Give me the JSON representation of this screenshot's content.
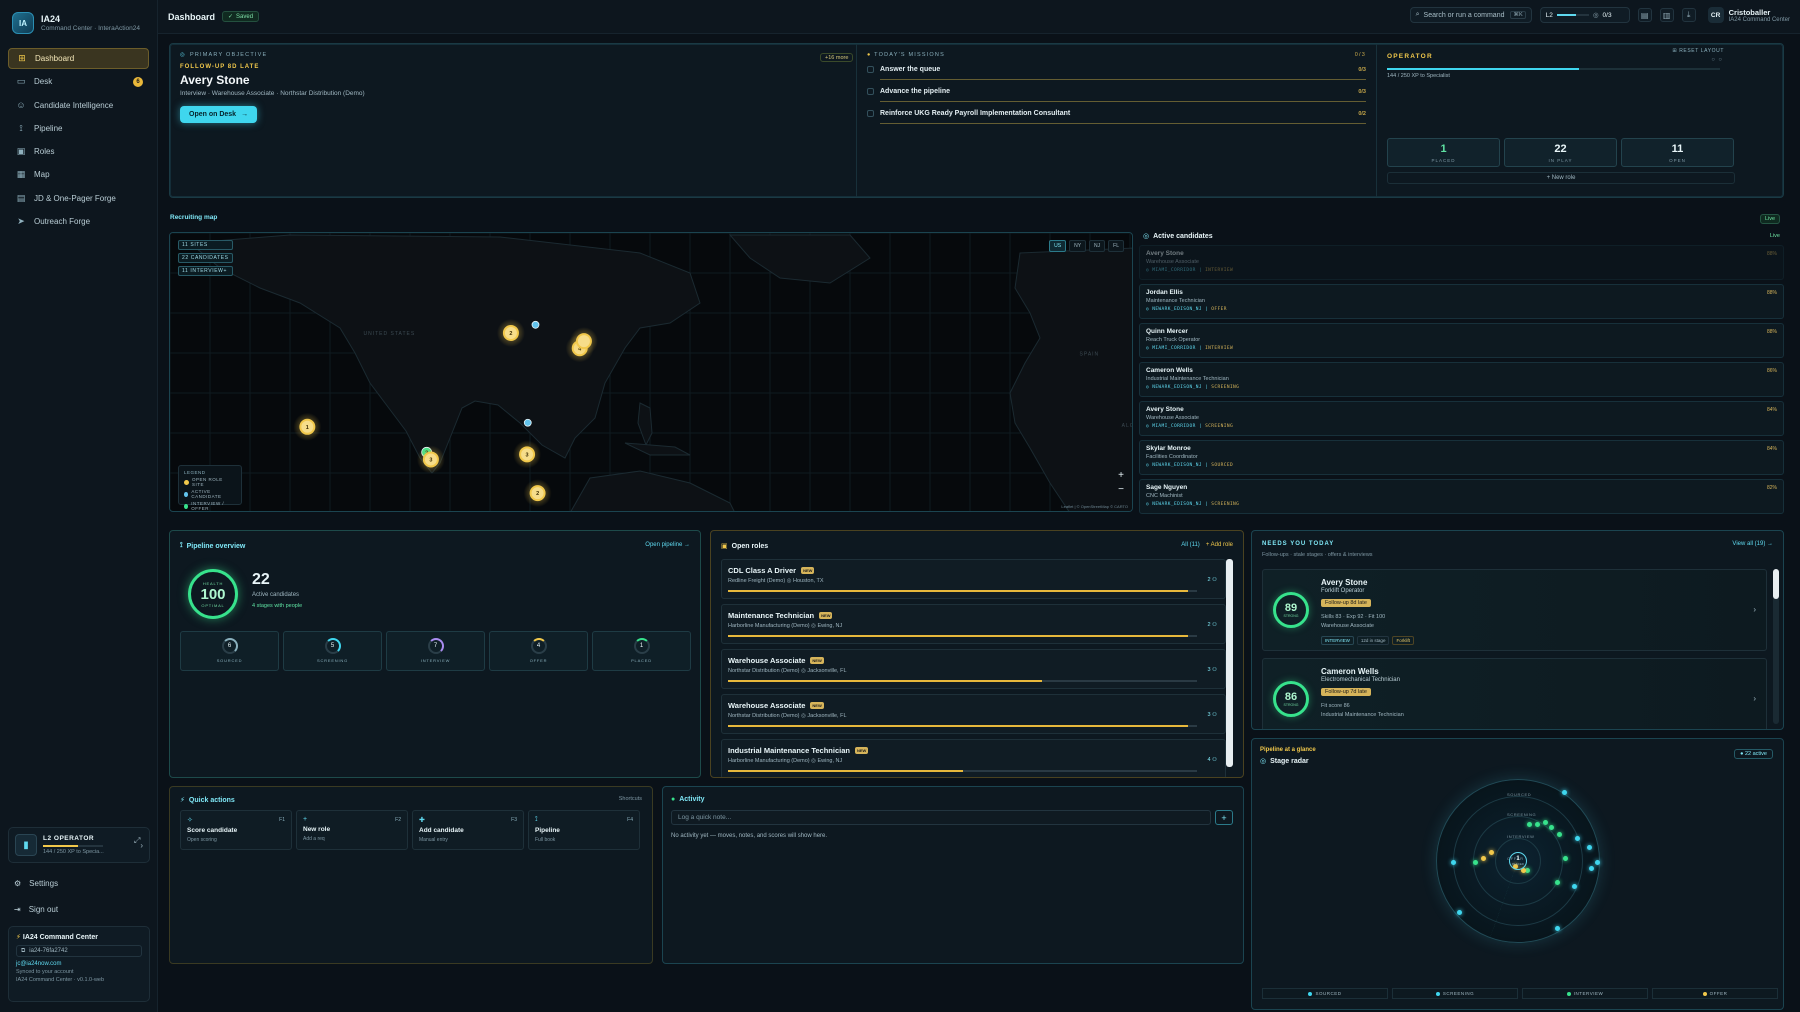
{
  "brand": {
    "title": "IA24",
    "subtitle": "Command Center · InteraAction24",
    "logo": "IA"
  },
  "nav": [
    {
      "label": "Dashboard",
      "icon": "grid-icon",
      "active": true
    },
    {
      "label": "Desk",
      "icon": "desk-icon",
      "badge": "6"
    },
    {
      "label": "Candidate Intelligence",
      "icon": "people-icon"
    },
    {
      "label": "Pipeline",
      "icon": "pipeline-icon"
    },
    {
      "label": "Roles",
      "icon": "briefcase-icon"
    },
    {
      "label": "Map",
      "icon": "map-icon"
    },
    {
      "label": "JD & One-Pager Forge",
      "icon": "document-icon"
    },
    {
      "label": "Outreach Forge",
      "icon": "send-icon"
    }
  ],
  "sidebar_operator": {
    "title": "L2 OPERATOR",
    "xp": "144 / 250 XP to Specia...",
    "progress": 0.576
  },
  "sidebar_links": {
    "settings": "Settings",
    "signout": "Sign out"
  },
  "sidebar_footer": {
    "title": "IA24 Command Center",
    "id": "ia24-76fa2742",
    "email": "jc@ia24now.com",
    "synced": "Synced to your account",
    "version": "IA24 Command Center · v0.1.0-web"
  },
  "header": {
    "title": "Dashboard",
    "saved": "Saved",
    "search": "Search or run a command",
    "kbd": "⌘K",
    "level": "L2",
    "level_stat": "0/3",
    "user_initials": "CR",
    "user_name": "Cristoballer",
    "user_org": "IA24 Command Center"
  },
  "hero": {
    "objective": "PRIMARY OBJECTIVE",
    "late": "FOLLOW-UP 8D LATE",
    "name": "Avery Stone",
    "sub": "Interview · Warehouse Associate · Northstar Distribution (Demo)",
    "button": "Open on Desk",
    "more": "+16 more"
  },
  "missions": {
    "title": "TODAY'S MISSIONS",
    "count": "0/3",
    "items": [
      {
        "label": "Answer the queue",
        "count": "0/3"
      },
      {
        "label": "Advance the pipeline",
        "count": "0/3"
      },
      {
        "label": "Reinforce UKG Ready Payroll Implementation Consultant",
        "count": "0/2"
      }
    ]
  },
  "operator": {
    "label": "OPERATOR",
    "xp": "144 / 250 XP to Specialist",
    "progress": 0.576,
    "reset": "RESET LAYOUT",
    "stats": [
      {
        "value": "1",
        "label": "PLACED"
      },
      {
        "value": "22",
        "label": "IN PLAY"
      },
      {
        "value": "11",
        "label": "OPEN"
      }
    ],
    "new_role": "+ New role"
  },
  "map": {
    "label": "Recruiting map",
    "live": "Live",
    "tags": [
      "11 SITES",
      "22 CANDIDATES",
      "11 INTERVIEW+"
    ],
    "regions": [
      "US",
      "NY",
      "NJ",
      "FL"
    ],
    "active_region": "US",
    "legend_title": "LEGEND",
    "legend": [
      "OPEN ROLE SITE",
      "ACTIVE CANDIDATE",
      "INTERVIEW / OFFER"
    ],
    "land_labels": [
      "UNITED STATES",
      "MEXICO",
      "SPAIN",
      "ALGERIA"
    ],
    "attribution": "Leaflet | © OpenStreetMap © CARTO",
    "colors": {
      "role": "#f1c84b",
      "candidate": "#62c3ec",
      "interview": "#37e28c"
    },
    "markers": [
      {
        "lon": -84.0,
        "lat": 42.2,
        "type": "role",
        "count": "2"
      },
      {
        "lon": -80.5,
        "lat": 43.0,
        "type": "candidate",
        "count": ""
      },
      {
        "lon": -74.2,
        "lat": 40.7,
        "type": "role",
        "count": "4"
      },
      {
        "lon": -73.6,
        "lat": 41.4,
        "type": "role",
        "count": ""
      },
      {
        "lon": -113.0,
        "lat": 33.0,
        "type": "role",
        "count": "1"
      },
      {
        "lon": -96.0,
        "lat": 30.5,
        "type": "interview",
        "count": "2"
      },
      {
        "lon": -95.4,
        "lat": 29.8,
        "type": "role",
        "count": "3"
      },
      {
        "lon": -81.6,
        "lat": 33.4,
        "type": "candidate",
        "count": ""
      },
      {
        "lon": -81.7,
        "lat": 30.3,
        "type": "role",
        "count": "3"
      },
      {
        "lon": -80.2,
        "lat": 26.5,
        "type": "role",
        "count": "2"
      }
    ]
  },
  "candidates": {
    "title": "Active candidates",
    "live": "Live",
    "items": [
      {
        "name": "Avery Stone",
        "role": "Warehouse Associate",
        "meta": "◎ MIAMI_CORRIDOR",
        "stage": "INTERVIEW",
        "pct": "88%"
      },
      {
        "name": "Jordan Ellis",
        "role": "Maintenance Technician",
        "meta": "◎ NEWARK_EDISON_NJ",
        "stage": "OFFER",
        "pct": "88%"
      },
      {
        "name": "Quinn Mercer",
        "role": "Reach Truck Operator",
        "meta": "◎ MIAMI_CORRIDOR",
        "stage": "INTERVIEW",
        "pct": "88%"
      },
      {
        "name": "Cameron Wells",
        "role": "Industrial Maintenance Technician",
        "meta": "◎ NEWARK_EDISON_NJ",
        "stage": "SCREENING",
        "pct": "86%"
      },
      {
        "name": "Avery Stone",
        "role": "Warehouse Associate",
        "meta": "◎ MIAMI_CORRIDOR",
        "stage": "SCREENING",
        "pct": "84%"
      },
      {
        "name": "Skylar Monroe",
        "role": "Facilities Coordinator",
        "meta": "◎ NEWARK_EDISON_NJ",
        "stage": "SOURCED",
        "pct": "84%"
      },
      {
        "name": "Sage Nguyen",
        "role": "CNC Machinist",
        "meta": "◎ NEWARK_EDISON_NJ",
        "stage": "SCREENING",
        "pct": "82%"
      }
    ]
  },
  "pipeline": {
    "title": "Pipeline overview",
    "link": "Open pipeline →",
    "score": "100",
    "score_label": "OPTIMAL",
    "score_top": "HEALTH",
    "total": "22",
    "total_label": "Active candidates",
    "stages_note": "4 stages with people",
    "stages": [
      {
        "value": "6",
        "label": "SOURCED",
        "color": "#8ab0bd",
        "fill": 0.27
      },
      {
        "value": "5",
        "label": "SCREENING",
        "color": "#3fd6ee",
        "fill": 0.23
      },
      {
        "value": "7",
        "label": "INTERVIEW",
        "color": "#a98cf0",
        "fill": 0.32
      },
      {
        "value": "4",
        "label": "OFFER",
        "color": "#f1c84b",
        "fill": 0.18
      },
      {
        "value": "1",
        "label": "PLACED",
        "color": "#37e28c",
        "fill": 0.05
      }
    ]
  },
  "roles": {
    "title": "Open roles",
    "link_all": "All (11)",
    "link_add": "+ Add role",
    "new": "NEW",
    "items": [
      {
        "title": "CDL Class A Driver",
        "company": "Redline Freight (Demo)",
        "location": "◎ Houston, TX",
        "count": "2 ⚇",
        "fill": 0.98
      },
      {
        "title": "Maintenance Technician",
        "company": "Harborline Manufacturing (Demo)",
        "location": "◎ Ewing, NJ",
        "count": "2 ⚇",
        "fill": 0.98
      },
      {
        "title": "Warehouse Associate",
        "company": "Northstar Distribution (Demo)",
        "location": "◎ Jacksonville, FL",
        "count": "3 ⚇",
        "fill": 0.67
      },
      {
        "title": "Warehouse Associate",
        "company": "Northstar Distribution (Demo)",
        "location": "◎ Jacksonville, FL",
        "count": "3 ⚇",
        "fill": 0.98
      },
      {
        "title": "Industrial Maintenance Technician",
        "company": "Harborline Manufacturing (Demo)",
        "location": "◎ Ewing, NJ",
        "count": "4 ⚇",
        "fill": 0.5
      }
    ]
  },
  "needs": {
    "title": "NEEDS YOU TODAY",
    "sub": "Follow-ups · stale stages · offers & interviews",
    "link": "View all (19) →",
    "items": [
      {
        "score": "89",
        "score_label": "STRONG",
        "name": "Avery Stone",
        "role": "Forklift Operator",
        "followup": "Follow-up 8d late",
        "detail": "Skills 83 · Exp 92 · Fit 100",
        "job": "Warehouse Associate",
        "tags": [
          "INTERVIEW",
          "12d in stage",
          "Forklift"
        ]
      },
      {
        "score": "86",
        "score_label": "STRONG",
        "name": "Cameron Wells",
        "role": "Electromechanical Technician",
        "followup": "Follow-up 7d late",
        "detail": "Fit score 86",
        "job": "Industrial Maintenance Technician",
        "tags": []
      }
    ]
  },
  "quick": {
    "title": "Quick actions",
    "shortcut": "Shortcuts",
    "items": [
      {
        "icon": "✧",
        "key": "F1",
        "title": "Score candidate",
        "sub": "Open scoring"
      },
      {
        "icon": "+",
        "key": "F2",
        "title": "New role",
        "sub": "Add a req"
      },
      {
        "icon": "✚",
        "key": "F3",
        "title": "Add candidate",
        "sub": "Manual entry"
      },
      {
        "icon": "⟟",
        "key": "F4",
        "title": "Pipeline",
        "sub": "Full book"
      }
    ]
  },
  "activity": {
    "title": "Activity",
    "placeholder": "Log a quick note...",
    "empty": "No activity yet — moves, notes, and scores will show here.",
    "add": "+"
  },
  "radar": {
    "section": "Pipeline at a glance",
    "title": "Stage radar",
    "active": "● 22 active",
    "center": "1",
    "center_label": "PLACED",
    "ring_labels": [
      "SOURCED",
      "SCREENING",
      "INTERVIEW",
      "OFFER"
    ],
    "legend": [
      {
        "label": "SOURCED",
        "color": "#3fd6ee"
      },
      {
        "label": "SCREENING",
        "color": "#3fd6ee"
      },
      {
        "label": "INTERVIEW",
        "color": "#37e28c"
      },
      {
        "label": "OFFER",
        "color": "#f1c84b"
      }
    ]
  }
}
